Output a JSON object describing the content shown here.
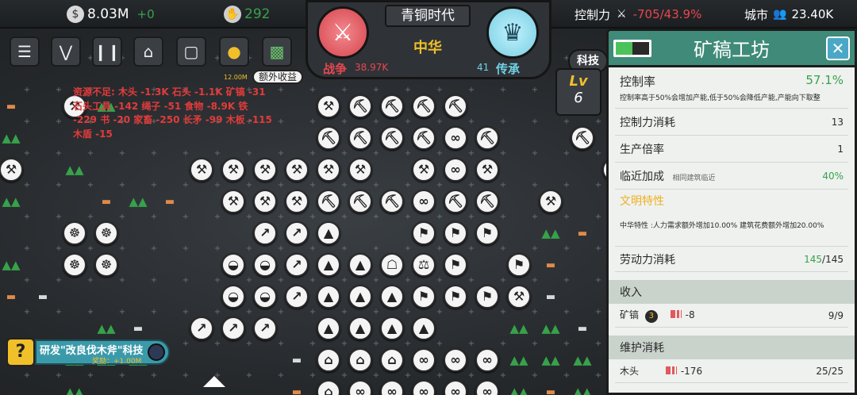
{
  "topbar": {
    "gold": "8.03M",
    "gold_delta": "+0",
    "power": "292",
    "control_label": "控制力",
    "control_value": "-705",
    "control_pct": "/43.9%",
    "city_label": "城市",
    "population": "23.40K"
  },
  "era": {
    "name": "青铜时代",
    "civ": "中华",
    "war_label": "战争",
    "war_value": "38.97K",
    "heritage_label": "传承",
    "heritage_value": "41",
    "tech_label": "科技",
    "lv_label": "Lv",
    "lv_value": "6"
  },
  "map": {
    "extra_income": "额外收益",
    "timer": "12.00M",
    "warning_lines": [
      "资源不足: 木头 -1.3K 石头 -1.1K 矿镐 -31",
      "石头工具 -142 绳子 -51 食物 -8.9K 铁",
      "-229 书 -20 家畜 -250 长矛 -99 木板 -115",
      "木盾 -15"
    ]
  },
  "quest": {
    "title": "研发\"改良伐木斧\"科技",
    "reward": "奖励：+1.00M"
  },
  "panel": {
    "title": "矿稿工坊",
    "rows": {
      "control_rate_label": "控制率",
      "control_rate_value": "57.1%",
      "control_rate_note": "控制率高于50%会增加产能,低于50%会降低产能,产能向下取整",
      "control_cost_label": "控制力消耗",
      "control_cost_value": "13",
      "multiplier_label": "生产倍率",
      "multiplier_value": "1",
      "adjacency_label": "临近加成",
      "adjacency_note": "相同建筑临近",
      "adjacency_value": "40%",
      "civ_trait_label": "文明特性",
      "civ_trait_text": "中华特性 :人力需求额外增加10.00% 建筑花费额外增加20.00%",
      "labor_label": "劳动力消耗",
      "labor_used": "145",
      "labor_total": "/145"
    },
    "income_section": "收入",
    "income_item": "矿镐",
    "income_badge": "3",
    "income_delta": "-8",
    "income_amount": "9/9",
    "upkeep_section": "维护消耗",
    "upkeep_item": "木头",
    "upkeep_delta": "-176",
    "upkeep_amount": "25/25"
  },
  "colors": {
    "panel_header": "#3f8a78",
    "war_red": "#e8474f",
    "civ_gold": "#f0c02a",
    "heritage_blue": "#6fd3e6",
    "positive_green": "#3aa14b",
    "warning_red": "#e23b3b"
  }
}
